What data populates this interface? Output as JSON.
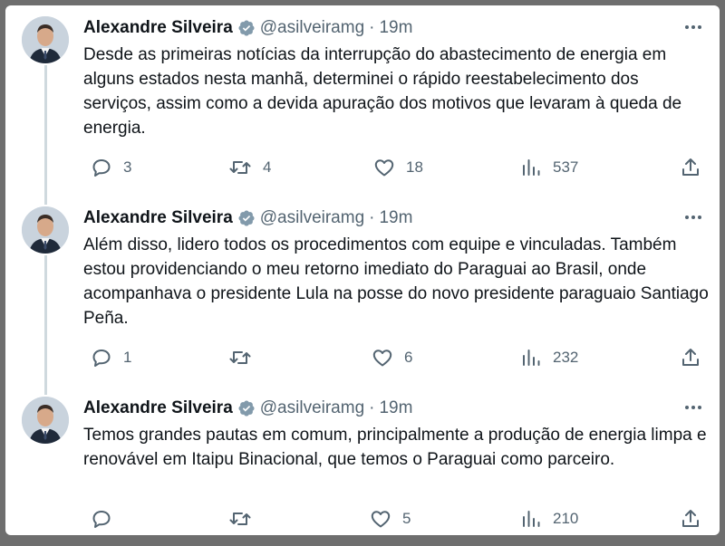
{
  "tweets": [
    {
      "author_name": "Alexandre Silveira",
      "handle": "@asilveiramg",
      "separator": "·",
      "time": "19m",
      "text": "Desde as primeiras notícias da interrupção do abastecimento de energia em alguns estados nesta manhã, determinei o rápido reestabelecimento dos serviços, assim como a devida apuração dos motivos que levaram à queda de energia.",
      "replies": "3",
      "retweets": "4",
      "likes": "18",
      "views": "537"
    },
    {
      "author_name": "Alexandre Silveira",
      "handle": "@asilveiramg",
      "separator": "·",
      "time": "19m",
      "text": "Além disso, lidero todos os procedimentos com equipe e vinculadas. Também estou providenciando o meu retorno imediato do Paraguai ao Brasil, onde acompanhava o presidente Lula na posse do novo presidente paraguaio Santiago Peña.",
      "replies": "1",
      "retweets": "",
      "likes": "6",
      "views": "232"
    },
    {
      "author_name": "Alexandre Silveira",
      "handle": "@asilveiramg",
      "separator": "·",
      "time": "19m",
      "text": "Temos grandes pautas em comum, principalmente a produção de energia limpa e renovável em Itaipu Binacional, que temos o Paraguai como parceiro.",
      "replies": "",
      "retweets": "",
      "likes": "5",
      "views": "210"
    }
  ],
  "icons": {
    "verified": "verified-badge-icon",
    "more": "more-options-icon",
    "reply": "reply-icon",
    "retweet": "retweet-icon",
    "like": "like-icon",
    "views": "views-icon",
    "share": "share-icon"
  },
  "colors": {
    "text": "#0f1419",
    "secondary": "#536471",
    "verified_badge": "#829aab",
    "thread_line": "#cfd9de"
  }
}
